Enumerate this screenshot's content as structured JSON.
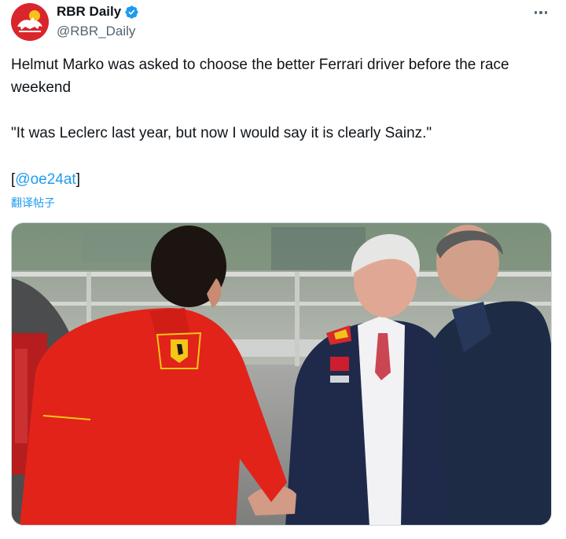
{
  "author": {
    "display_name": "RBR Daily",
    "handle": "@RBR_Daily",
    "avatar_icon": "red-bull-logo-icon",
    "verified_icon": "verified-badge-icon"
  },
  "menu": {
    "icon": "more-options-icon"
  },
  "tweet": {
    "paragraph1": "Helmut Marko was asked to choose the better Ferrari driver before the race weekend",
    "paragraph2": "\"It was Leclerc last year, but now I would say it is clearly Sainz.\"",
    "source_open": "[",
    "source_mention": "@oe24at",
    "source_close": "]"
  },
  "translate_label": "翻译帖子",
  "colors": {
    "link": "#1d9bf0",
    "verified": "#1d9bf0",
    "text": "#0f1419",
    "secondary": "#536471",
    "ferrari_red": "#e2231a",
    "navy_jacket": "#1c2c4c"
  }
}
